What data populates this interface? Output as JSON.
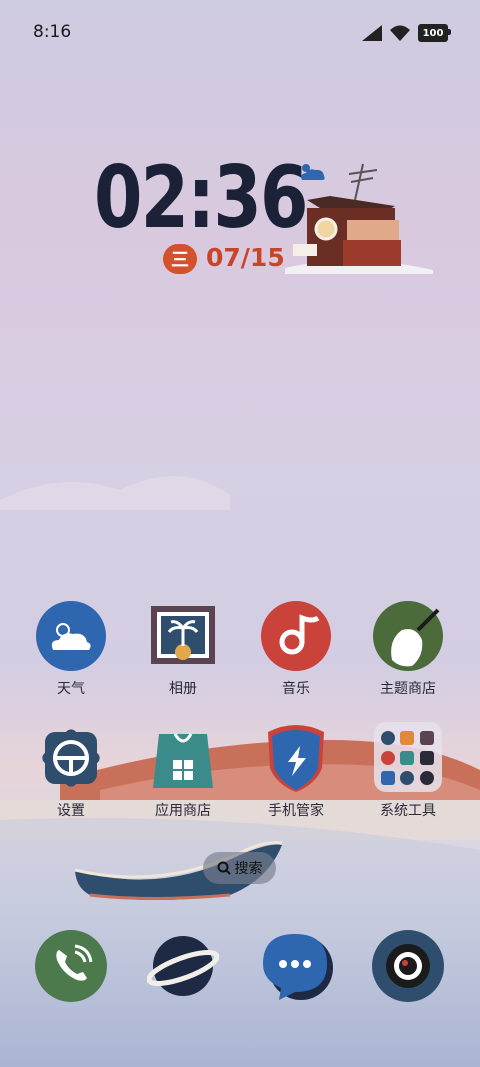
{
  "status": {
    "time": "8:16",
    "battery": "100"
  },
  "clock": {
    "time": "02:36",
    "weekday": "三",
    "date": "07/15"
  },
  "apps_row1": [
    {
      "label": "天气"
    },
    {
      "label": "相册"
    },
    {
      "label": "音乐"
    },
    {
      "label": "主题商店"
    }
  ],
  "apps_row2": [
    {
      "label": "设置"
    },
    {
      "label": "应用商店"
    },
    {
      "label": "手机管家"
    },
    {
      "label": "系统工具"
    }
  ],
  "search": {
    "label": "搜索"
  },
  "dock_icons": [
    "phone-icon",
    "browser-icon",
    "messages-icon",
    "camera-icon"
  ],
  "colors": {
    "accent": "#d4512d",
    "clock": "#1b2238",
    "weather": "#2e66b0",
    "music": "#c9433a",
    "phone": "#4c7a4c"
  }
}
